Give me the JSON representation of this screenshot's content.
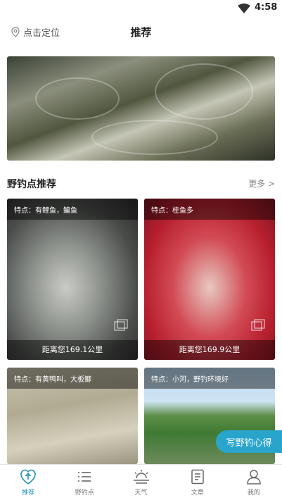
{
  "status": {
    "time": "4:58"
  },
  "header": {
    "location_label": "点击定位",
    "title": "推荐"
  },
  "section": {
    "title": "野钓点推荐",
    "more": "更多 >"
  },
  "spots": [
    {
      "feature": "特点：有鲤鱼，鳊鱼",
      "distance": "距离您169.1公里"
    },
    {
      "feature": "特点：桂鱼多",
      "distance": "距离您169.9公里"
    },
    {
      "feature": "特点：有黄鸭叫，大板鲫"
    },
    {
      "feature": "特点：小河，野钓环境好"
    }
  ],
  "write_button": "写野钓心得",
  "tabs": [
    {
      "label": "推荐",
      "icon": "recommend-icon"
    },
    {
      "label": "野钓点",
      "icon": "list-icon"
    },
    {
      "label": "天气",
      "icon": "weather-icon"
    },
    {
      "label": "文章",
      "icon": "article-icon"
    },
    {
      "label": "我的",
      "icon": "profile-icon"
    }
  ],
  "colors": {
    "accent": "#1f8fb8",
    "button": "#29a5cc"
  }
}
